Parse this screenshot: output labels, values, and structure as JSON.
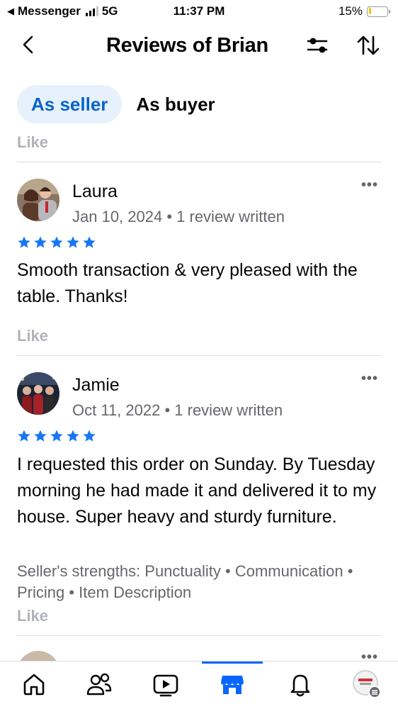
{
  "status_bar": {
    "carrier": "Messenger",
    "network": "5G",
    "time": "11:37 PM",
    "battery": "15%",
    "battery_level": 0.15
  },
  "header": {
    "title": "Reviews of Brian",
    "back_icon": "chevron-left-icon",
    "filter_icon": "filter-sliders-icon",
    "sort_icon": "sort-arrows-icon"
  },
  "tabs": [
    {
      "label": "As seller",
      "active": true
    },
    {
      "label": "As buyer",
      "active": false
    }
  ],
  "top_like": "Like",
  "reviews": [
    {
      "name": "Laura",
      "meta": "Jan 10, 2024 • 1 review written",
      "rating": 5,
      "text": "Smooth transaction & very pleased with the table. Thanks!",
      "more": "•••",
      "like": "Like"
    },
    {
      "name": "Jamie",
      "meta": "Oct 11, 2022 • 1 review written",
      "rating": 5,
      "text": "I requested this order on Sunday. By Tuesday morning he had made it and delivered it to my house. Super heavy and sturdy furniture.",
      "strengths": "Seller's strengths: Punctuality • Communication • Pricing • Item Description",
      "more": "•••",
      "like": "Like"
    }
  ],
  "bottom_nav": [
    {
      "icon": "home-icon",
      "active": false
    },
    {
      "icon": "friends-icon",
      "active": false
    },
    {
      "icon": "video-icon",
      "active": false
    },
    {
      "icon": "marketplace-icon",
      "active": true
    },
    {
      "icon": "bell-icon",
      "active": false
    },
    {
      "icon": "profile-menu-icon",
      "active": false
    }
  ],
  "colors": {
    "accent": "#0866ff",
    "tab_active_bg": "#e7f1fc",
    "tab_active_text": "#0a64c9",
    "secondary_text": "#65676b",
    "muted_text": "#b0b3b8",
    "star": "#1877f2"
  }
}
